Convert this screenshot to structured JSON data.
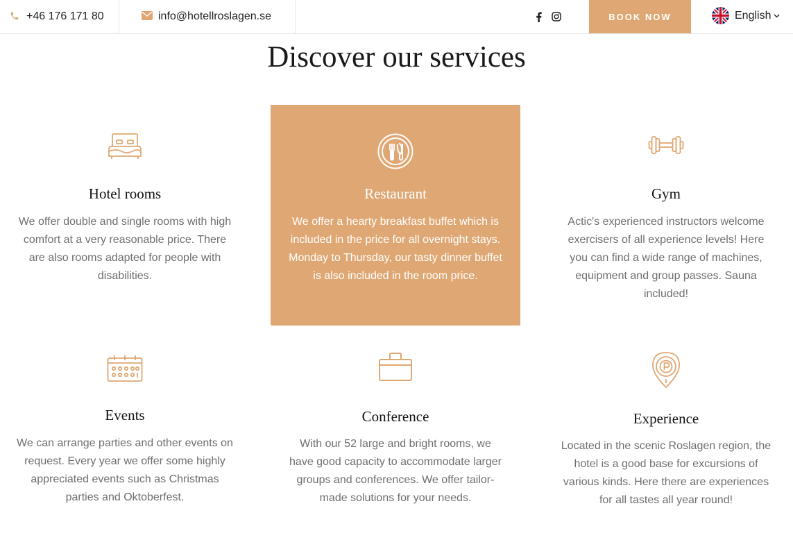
{
  "topbar": {
    "phone": "+46 176 171 80",
    "email": "info@hotellroslagen.se",
    "social": [
      {
        "icon": "facebook-icon",
        "glyph": "f"
      },
      {
        "icon": "instagram-icon"
      }
    ],
    "book_label": "BOOK NOW",
    "language": "English"
  },
  "colors": {
    "accent": "#dfa773",
    "text_muted": "#6e6e6e",
    "heading": "#1a1a1a"
  },
  "page_title": "Discover our services",
  "services": [
    {
      "icon": "bed-icon",
      "title": "Hotel rooms",
      "text": "We offer double and single rooms with high comfort at a very reasonable price. There are also rooms adapted for people with disabilities.",
      "highlighted": false
    },
    {
      "icon": "restaurant-icon",
      "title": "Restaurant",
      "text": "We offer a hearty breakfast buffet which is included in the price for all overnight stays. Monday to Thursday, our tasty dinner buffet is also included in the room price.",
      "highlighted": true
    },
    {
      "icon": "dumbbell-icon",
      "title": "Gym",
      "text": "Actic's experienced instructors welcome exercisers of all experience levels! Here you can find a wide range of machines, equipment and group passes. Sauna included!",
      "highlighted": false
    },
    {
      "icon": "calendar-icon",
      "title": "Events",
      "text": "We can arrange parties and other events on request. Every year we offer some highly appreciated events such as Christmas parties and Oktoberfest.",
      "highlighted": false
    },
    {
      "icon": "briefcase-icon",
      "title": "Conference",
      "text": "With our 52 large and bright rooms, we have good capacity to accommodate larger groups and conferences. We offer tailor-made solutions for your needs.",
      "highlighted": false
    },
    {
      "icon": "map-pin-icon",
      "title": "Experience",
      "text": "Located in the scenic Roslagen region, the hotel is a good base for excursions of various kinds. Here there are experiences for all tastes all year round!",
      "highlighted": false
    }
  ]
}
